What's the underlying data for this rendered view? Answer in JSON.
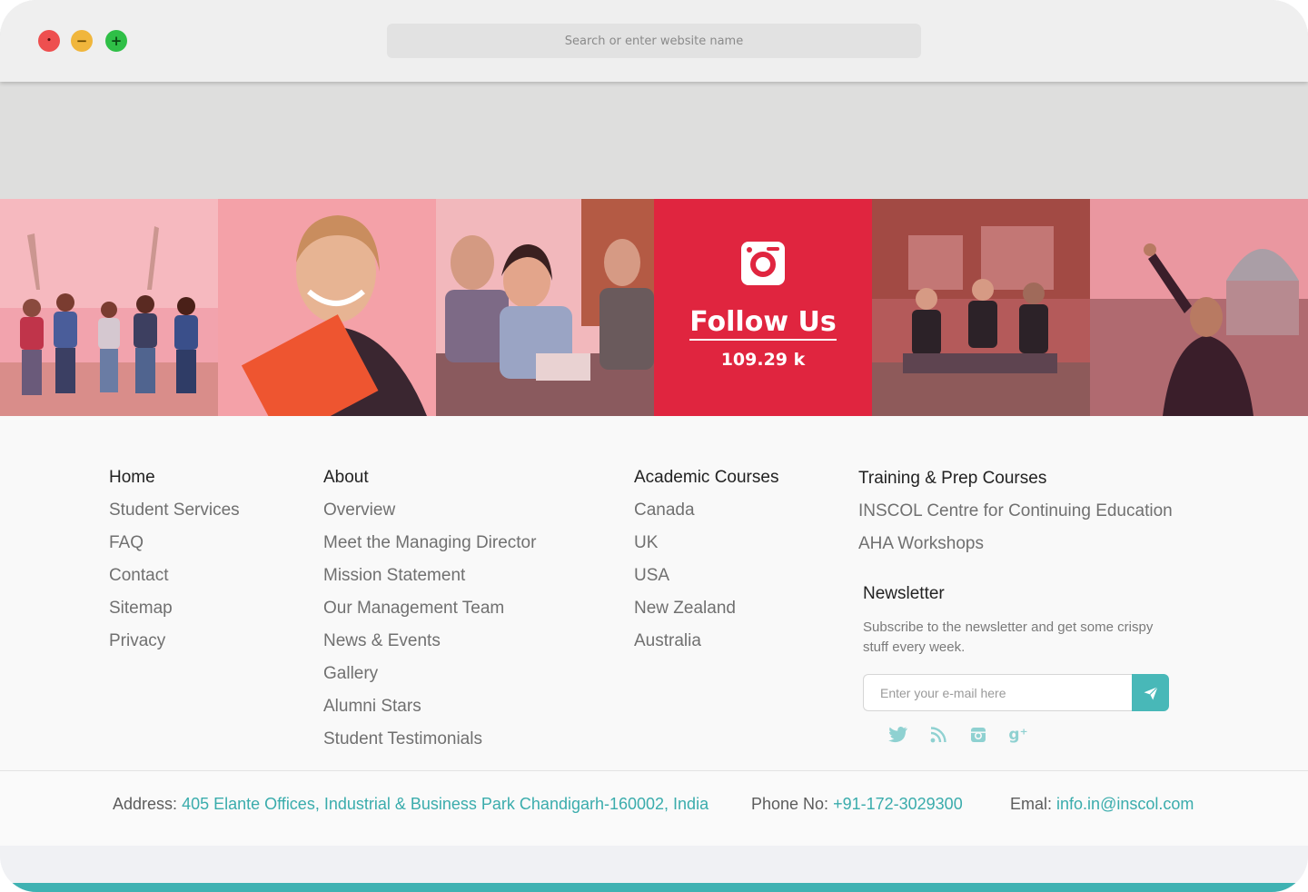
{
  "browser": {
    "address_placeholder": "Search or enter website name",
    "controls": {
      "close": "•",
      "minimize": "−",
      "maximize": "+"
    }
  },
  "instagram_strip": {
    "follow_title": "Follow Us",
    "follower_count": "109.29 k",
    "icon": "instagram-icon"
  },
  "footer": {
    "col1": {
      "title": "Home",
      "links": [
        "Student Services",
        "FAQ",
        "Contact",
        "Sitemap",
        "Privacy"
      ]
    },
    "col2": {
      "title": "About",
      "links": [
        "Overview",
        "Meet the Managing Director",
        "Mission Statement",
        "Our Management Team",
        "News & Events",
        "Gallery",
        "Alumni Stars",
        "Student Testimonials"
      ]
    },
    "col3": {
      "title": "Academic Courses",
      "links": [
        "Canada",
        "UK",
        "USA",
        "New Zealand",
        "Australia"
      ]
    },
    "col4": {
      "title": "Training & Prep Courses",
      "links": [
        "INSCOL Centre for Continuing Education",
        "AHA Workshops"
      ]
    },
    "newsletter": {
      "title": "Newsletter",
      "description": "Subscribe to the newsletter and get some crispy stuff every week.",
      "email_placeholder": "Enter your e-mail here",
      "socials": [
        "twitter-icon",
        "rss-icon",
        "instagram-icon",
        "google-plus-icon"
      ]
    }
  },
  "contact": {
    "address_label": "Address:",
    "address_value": "405 Elante Offices, Industrial & Business Park Chandigarh-160002, India",
    "phone_label": "Phone No:",
    "phone_value": "+91-172-3029300",
    "email_label": "Emal:",
    "email_value": "info.in@inscol.com"
  },
  "colors": {
    "accent": "#48b8b8",
    "brand_red": "#e0253f",
    "tint": "#e8576e"
  }
}
